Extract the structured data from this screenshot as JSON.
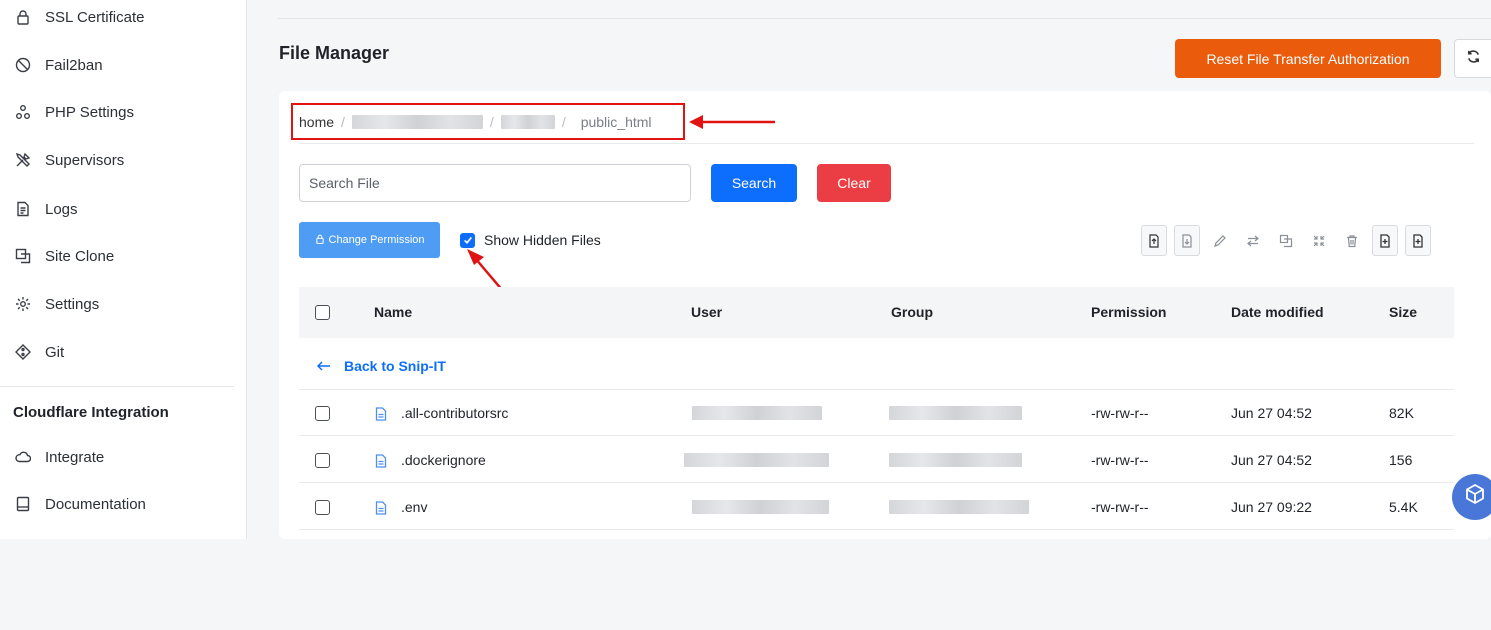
{
  "sidebar": {
    "items": [
      {
        "label": "SSL Certificate",
        "icon": "lock-icon"
      },
      {
        "label": "Fail2ban",
        "icon": "ban-icon"
      },
      {
        "label": "PHP Settings",
        "icon": "nodes-icon"
      },
      {
        "label": "Supervisors",
        "icon": "tools-icon"
      },
      {
        "label": "Logs",
        "icon": "document-icon"
      },
      {
        "label": "Site Clone",
        "icon": "copy-icon"
      },
      {
        "label": "Settings",
        "icon": "gear-icon"
      },
      {
        "label": "Git",
        "icon": "git-icon"
      }
    ],
    "section_title": "Cloudflare Integration",
    "section_items": [
      {
        "label": "Integrate",
        "icon": "cloud-icon"
      },
      {
        "label": "Documentation",
        "icon": "book-icon"
      }
    ]
  },
  "page": {
    "title": "File Manager",
    "reset_button": "Reset File Transfer Authorization"
  },
  "breadcrumb": {
    "home": "home",
    "last": "public_html"
  },
  "search": {
    "placeholder": "Search File",
    "search_button": "Search",
    "clear_button": "Clear"
  },
  "actions": {
    "change_permission": "Change Permission",
    "show_hidden": "Show Hidden Files",
    "show_hidden_checked": true
  },
  "table": {
    "columns": [
      "Name",
      "User",
      "Group",
      "Permission",
      "Date modified",
      "Size"
    ],
    "back_link": "Back to Snip-IT",
    "rows": [
      {
        "name": ".all-contributorsrc",
        "permission": "-rw-rw-r--",
        "date": "Jun 27 04:52",
        "size": "82K"
      },
      {
        "name": ".dockerignore",
        "permission": "-rw-rw-r--",
        "date": "Jun 27 04:52",
        "size": "156"
      },
      {
        "name": ".env",
        "permission": "-rw-rw-r--",
        "date": "Jun 27 09:22",
        "size": "5.4K"
      }
    ]
  },
  "colors": {
    "accent_orange": "#ea5b0c",
    "primary_blue": "#0d6efd",
    "danger_red": "#ea3e44",
    "annotation_red": "#e01212"
  }
}
